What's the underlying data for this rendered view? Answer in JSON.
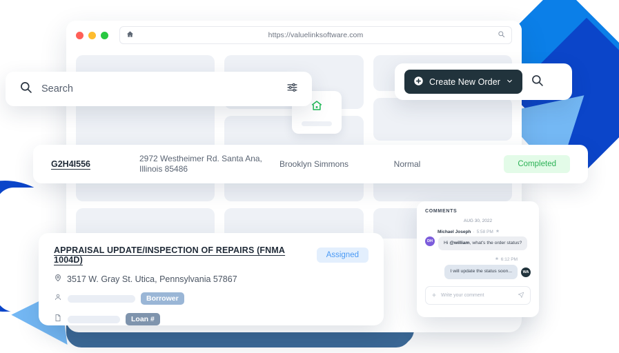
{
  "browser": {
    "url": "https://valuelinksoftware.com",
    "home_icon": "home-icon",
    "url_search_icon": "search-icon",
    "traffic_lights": [
      "close-red",
      "minimize-yellow",
      "maximize-green"
    ]
  },
  "search": {
    "placeholder": "Search",
    "icon": "search-icon",
    "filter_icon": "filter-sliders-icon"
  },
  "create_order": {
    "label": "Create New Order",
    "plus_icon": "plus-circle-icon",
    "chevron_icon": "chevron-down-icon",
    "search_icon": "search-icon",
    "button_color": "#21333c"
  },
  "order_row": {
    "id": "G2H4I556",
    "address": "2972 Westheimer Rd. Santa Ana, Illinois 85486",
    "contact": "Brooklyn Simmons",
    "priority": "Normal",
    "status": "Completed",
    "status_bg": "#e3fbe8",
    "status_color": "#2bb155"
  },
  "appraisal": {
    "title": "APPRAISAL UPDATE/INSPECTION OF REPAIRS (FNMA 1004D)",
    "status": "Assigned",
    "status_bg": "#e3effd",
    "status_color": "#4a9af5",
    "address": "3517 W. Gray St. Utica, Pennsylvania 57867",
    "location_icon": "map-pin-icon",
    "person_icon": "user-icon",
    "document_icon": "document-icon",
    "borrower_chip": "Borrower",
    "loan_chip": "Loan #"
  },
  "comments": {
    "heading": "COMMENTS",
    "date": "AUG 30, 2022",
    "messages": [
      {
        "author": "Michael Joseph",
        "time": "5:58 PM",
        "avatar_initials": "DH",
        "avatar_color": "#7c5cdb",
        "text_prefix": "Hi ",
        "mention": "@william",
        "text_suffix": ", what's the order status?",
        "side": "left"
      },
      {
        "author": "",
        "time": "6:12 PM",
        "avatar_initials": "WA",
        "avatar_color": "#21333c",
        "text": "I will update the status soon...",
        "side": "right"
      }
    ],
    "input_placeholder": "Write your comment",
    "plus_icon": "plus-icon",
    "send_icon": "send-icon",
    "star_icon": "star-icon"
  },
  "decor": {
    "house_icon": "house-icon",
    "house_icon_color": "#1db954",
    "blue_bright": "#0b7fe8",
    "blue_deep": "#0b45c9",
    "blue_light": "#74b8f4",
    "steel": "#3d6b99"
  }
}
